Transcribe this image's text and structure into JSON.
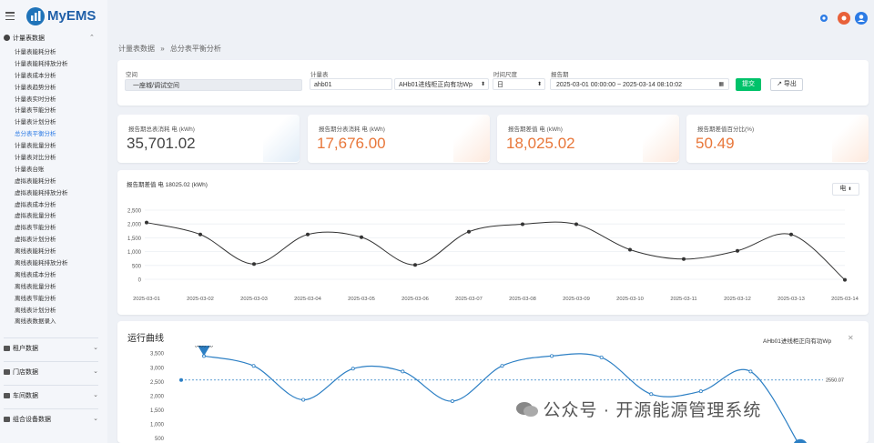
{
  "app": {
    "brand": "MyEMS"
  },
  "sidebar": {
    "group_label": "计量表数据",
    "items": [
      "计量表能耗分析",
      "计量表能耗排放分析",
      "计量表成本分析",
      "计量表趋势分析",
      "计量表实时分析",
      "计量表节能分析",
      "计量表计划分析",
      "总分表平衡分析",
      "计量表批量分析",
      "计量表对比分析",
      "计量表台账",
      "虚拟表能耗分析",
      "虚拟表能耗排放分析",
      "虚拟表成本分析",
      "虚拟表批量分析",
      "虚拟表节能分析",
      "虚拟表计划分析",
      "离线表能耗分析",
      "离线表能耗排放分析",
      "离线表成本分析",
      "离线表批量分析",
      "离线表节能分析",
      "离线表计划分析",
      "离线表数据录入"
    ],
    "active_index": 7,
    "sections": [
      "租户数据",
      "门店数据",
      "车间数据",
      "组合设备数据"
    ]
  },
  "breadcrumb": {
    "parent": "计量表数据",
    "sep": "»",
    "current": "总分表平衡分析"
  },
  "filters": {
    "space_label": "空间",
    "space_value": "一座城/调试空间",
    "meter_label": "计量表",
    "meter_value": "ahb01",
    "point_value": "AHb01进线柜正向有功Wp",
    "period_label": "时间尺度",
    "period_value": "日",
    "report_label": "报告期",
    "report_value": "2025-03-01 00:00:00 ~ 2025-03-14 08:10:02",
    "submit_label": "提交",
    "export_label": "导出"
  },
  "stats": [
    {
      "title": "报告期总表消耗 电 (kWh)",
      "value": "35,701.02",
      "color": "#444444",
      "deco": "#e0ecf7"
    },
    {
      "title": "报告期分表消耗 电 (kWh)",
      "value": "17,676.00",
      "color": "#e8773a",
      "deco": "#fde9dd"
    },
    {
      "title": "报告期差值 电 (kWh)",
      "value": "18,025.02",
      "color": "#e8773a",
      "deco": "#fde9dd"
    },
    {
      "title": "报告期差值百分比(%)",
      "value": "50.49",
      "color": "#e8773a",
      "deco": "#fde9dd"
    }
  ],
  "chart_data": [
    {
      "type": "line",
      "title": "报告期差值 电 18025.02 (kWh)",
      "selector": "电",
      "x": [
        "2025-03-01",
        "2025-03-02",
        "2025-03-03",
        "2025-03-04",
        "2025-03-05",
        "2025-03-06",
        "2025-03-07",
        "2025-03-08",
        "2025-03-09",
        "2025-03-10",
        "2025-03-11",
        "2025-03-12",
        "2025-03-13",
        "2025-03-14"
      ],
      "values": [
        2050,
        1620,
        550,
        1620,
        1520,
        520,
        1720,
        1990,
        1990,
        1070,
        730,
        1030,
        1620,
        -20
      ],
      "yticks": [
        "2,500",
        "2,000",
        "1,500",
        "1,000",
        "500",
        "0"
      ],
      "ylim": [
        0,
        2500
      ],
      "grid": true
    },
    {
      "type": "line",
      "title": "运行曲线",
      "legend": "AHb01进线柜正向有功Wp",
      "series": [
        {
          "name": "AHb01进线柜正向有功Wp",
          "values": [
            3400,
            3050,
            1850,
            2950,
            2850,
            1800,
            3050,
            3400,
            3350,
            2050,
            2150,
            2850,
            200
          ]
        }
      ],
      "max_label": "3400.18",
      "min_label": "59.28",
      "avg_label": "2550.07",
      "yticks": [
        "3,500",
        "3,000",
        "2,500",
        "2,000",
        "1,500",
        "1,000",
        "500"
      ],
      "ylim": [
        0,
        3700
      ]
    }
  ],
  "watermark": "公众号 · 开源能源管理系统"
}
